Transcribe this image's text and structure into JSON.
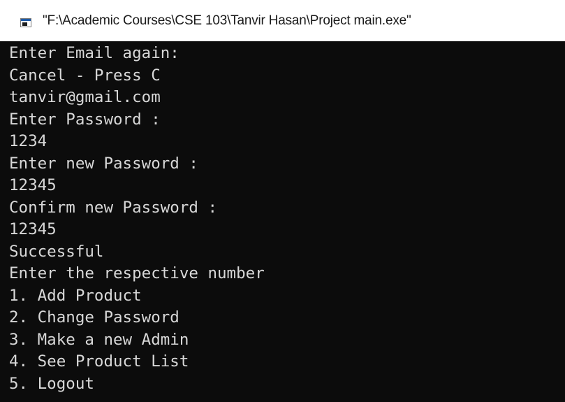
{
  "window": {
    "title": "\"F:\\Academic Courses\\CSE 103\\Tanvir Hasan\\Project main.exe\"",
    "icon": "console-app-icon"
  },
  "console": {
    "lines": [
      "Enter Email again:",
      "Cancel - Press C",
      "tanvir@gmail.com",
      "Enter Password :",
      "1234",
      "Enter new Password :",
      "12345",
      "Confirm new Password :",
      "12345",
      "Successful",
      "Enter the respective number",
      "1. Add Product",
      "2. Change Password",
      "3. Make a new Admin",
      "4. See Product List",
      "5. Logout"
    ]
  },
  "colors": {
    "console_bg": "#0c0c0c",
    "console_text": "#d8d8d8",
    "titlebar_bg": "#ffffff"
  }
}
